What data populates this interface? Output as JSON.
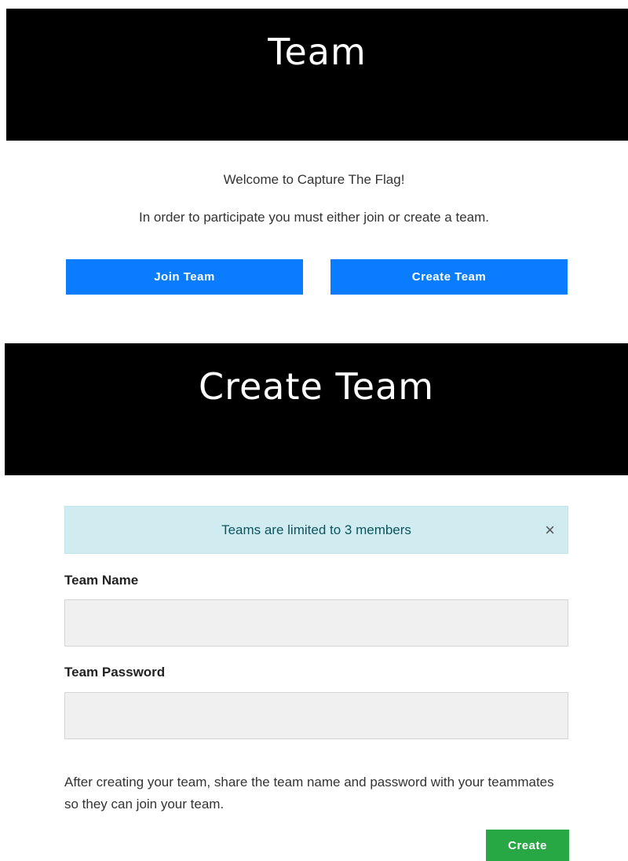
{
  "team_section": {
    "title": "Team",
    "welcome": "Welcome to Capture The Flag!",
    "instructions": "In order to participate you must either join or create a team.",
    "join_label": "Join Team",
    "create_label": "Create Team"
  },
  "create_section": {
    "title": "Create Team",
    "alert": {
      "text": "Teams are limited to 3 members",
      "close_glyph": "×"
    },
    "fields": {
      "name_label": "Team Name",
      "name_value": "",
      "password_label": "Team Password",
      "password_value": ""
    },
    "note": "After creating your team, share the team name and password with your teammates so they can join your team.",
    "submit_label": "Create"
  },
  "colors": {
    "banner": "#000000",
    "primary": "#0a7cff",
    "success": "#28a745",
    "alert_bg": "#d1ecf1",
    "alert_text": "#0c5460"
  }
}
